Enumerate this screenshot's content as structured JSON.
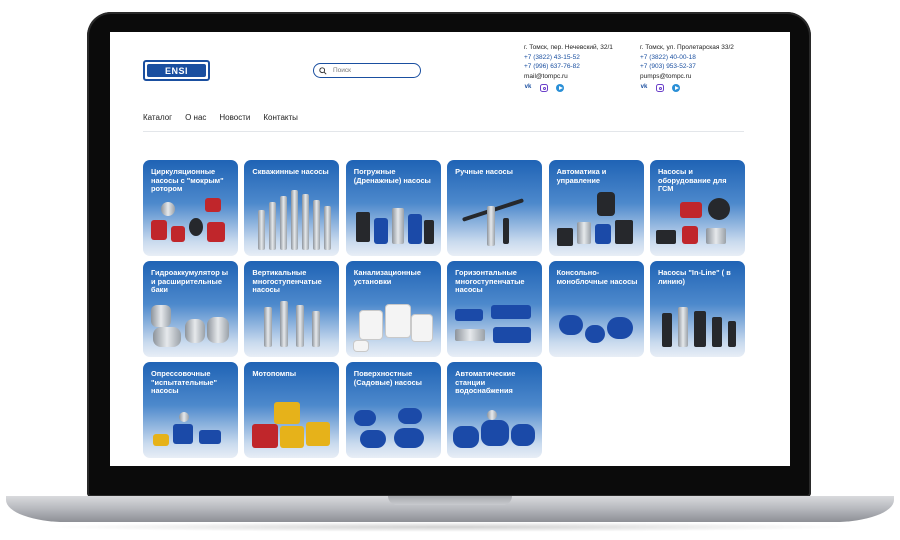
{
  "header": {
    "logo_text": "ENSI",
    "search_placeholder": "Поиск",
    "contacts": [
      {
        "address": "г. Томск, пер. Нечевский, 32/1",
        "phone1": "+7 (3822) 43-15-52",
        "phone2": "+7 (996) 637-76-82",
        "email": "mail@tompc.ru"
      },
      {
        "address": "г. Томск, ул. Пролетарская 33/2",
        "phone1": "+7 (3822) 40-00-18",
        "phone2": "+7 (903) 953-52-37",
        "email": "pumps@tompc.ru"
      }
    ],
    "social_icons": [
      "vk-icon",
      "instagram-icon",
      "telegram-icon"
    ]
  },
  "nav": {
    "items": [
      "Каталог",
      "О нас",
      "Новости",
      "Контакты"
    ]
  },
  "catalog": {
    "categories": [
      "Циркуляционные насосы с \"мокрым\" ротором",
      "Скважинные насосы",
      "Погружные (Дренажные) насосы",
      "Ручные насосы",
      "Автоматика и управление",
      "Насосы и оборудование для ГСМ",
      "Гидроаккумулятор ы и расширительные баки",
      "Вертикальные многоступенчатые насосы",
      "Канализационные установки",
      "Горизонтальные многоступенчатые насосы",
      "Консольно-моноблочные насосы",
      "Насосы \"In-Line\" ( в линию)",
      "Опрессовочные \"испытательные\" насосы",
      "Мотопомпы",
      "Поверхностные (Садовые) насосы",
      "Автоматические станции водоснабжения"
    ]
  },
  "colors": {
    "brand": "#1a4fa0",
    "card_top": "#1f63b5",
    "card_bottom": "#e8eef6",
    "link": "#1a4fa0"
  }
}
